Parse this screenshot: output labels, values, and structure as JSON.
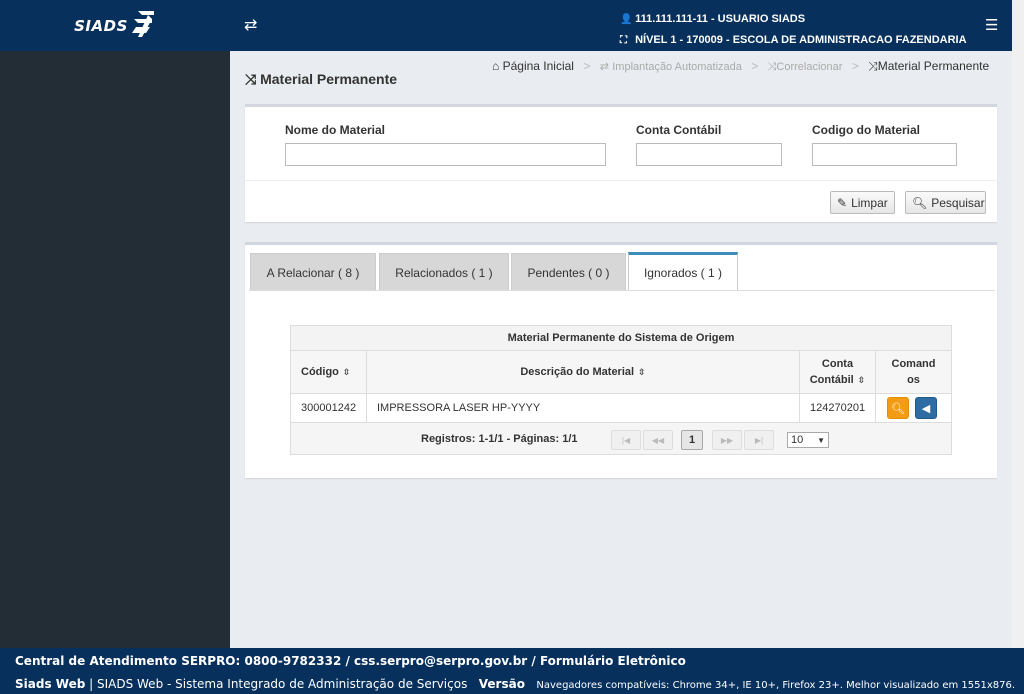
{
  "header": {
    "logo_text": "SIADS",
    "user_line": "111.111.111-11 - USUARIO SIADS",
    "level_line": "NÍVEL 1 - 170009 - ESCOLA DE ADMINISTRACAO FAZENDARIA"
  },
  "page": {
    "title": "Material Permanente"
  },
  "breadcrumb": {
    "home": "Página Inicial",
    "step1": "Implantação Automatizada",
    "step2": "Correlacionar",
    "current": "Material Permanente"
  },
  "filters": {
    "nome_label": "Nome do Material",
    "conta_label": "Conta Contábil",
    "codigo_label": "Codigo do Material",
    "nome_value": "",
    "conta_value": "",
    "codigo_value": "",
    "clear_label": "Limpar",
    "search_label": "Pesquisar"
  },
  "tabs": [
    {
      "label": "A Relacionar ( 8 )"
    },
    {
      "label": "Relacionados ( 1 )"
    },
    {
      "label": "Pendentes ( 0 )"
    },
    {
      "label": "Ignorados ( 1 )"
    }
  ],
  "active_tab": "Ignorados ( 1 )",
  "grid": {
    "caption": "Material Permanente do Sistema de Origem",
    "headers": {
      "codigo": "Código",
      "descricao": "Descrição do Material",
      "conta_l1": "Conta",
      "conta_l2": "Contábil",
      "comandos_l1": "Comand",
      "comandos_l2": "os"
    },
    "rows": [
      {
        "codigo": "300001242",
        "descricao": "IMPRESSORA LASER HP-YYYY",
        "conta": "124270201"
      }
    ],
    "pager": {
      "records_text": "Registros: 1-1/1 - Páginas: 1/1",
      "current_page": "1",
      "page_size": "10"
    }
  },
  "footer": {
    "line1": "Central de Atendimento SERPRO: 0800-9782332 / css.serpro@serpro.gov.br / Formulário Eletrônico",
    "app_name": "Siads Web",
    "app_desc": "SIADS Web - Sistema Integrado de Administração de Serviços",
    "version_label": "Versão",
    "browsers": "Navegadores compatíveis: Chrome 34+, IE 10+, Firefox 23+. Melhor visualizado em 1551x876."
  },
  "colors": {
    "header_bg": "#07305c",
    "sidebar_bg": "#232d35",
    "accent": "#3c8dbc",
    "search_btn": "#f39c12",
    "back_btn": "#2e6da4"
  }
}
